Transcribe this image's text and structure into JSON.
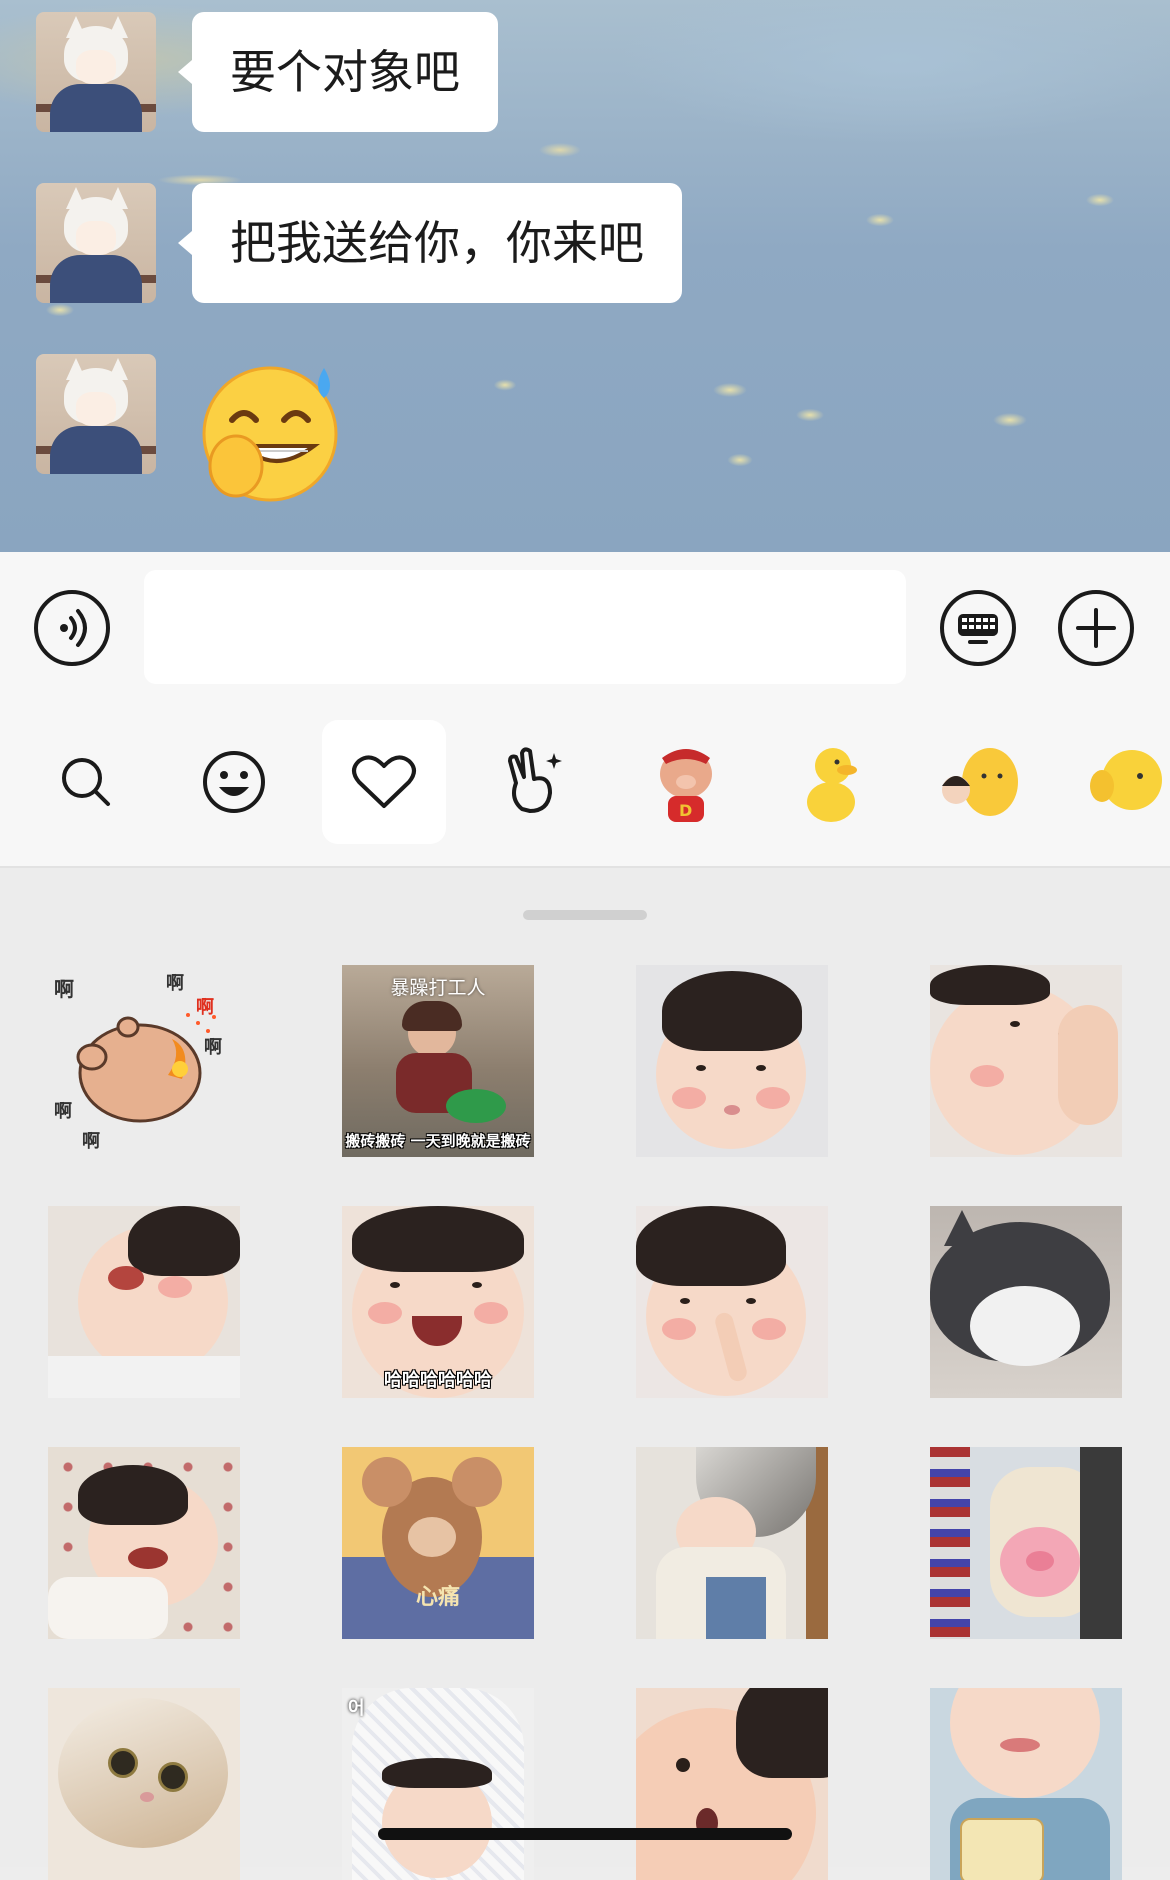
{
  "chat": {
    "messages": [
      {
        "type": "text",
        "text": "要个对象吧"
      },
      {
        "type": "text",
        "text": "把我送给你，你来吧"
      },
      {
        "type": "sticker",
        "icon": "grinning-sweat-emoji"
      }
    ]
  },
  "input": {
    "value": "",
    "voice_icon": "voice-icon",
    "keyboard_icon": "keyboard-icon",
    "plus_icon": "plus-icon"
  },
  "sticker_tabs": [
    {
      "icon": "search-icon"
    },
    {
      "icon": "smiley-icon"
    },
    {
      "icon": "heart-icon",
      "active": true
    },
    {
      "icon": "hand-gesture-icon"
    },
    {
      "icon": "pig-sticker-pack"
    },
    {
      "icon": "yellow-duck-pack"
    },
    {
      "icon": "duck-with-kid-pack"
    },
    {
      "icon": "yellow-duck-wave-pack"
    }
  ],
  "stickers": [
    {
      "name": "bear-ah-sticker",
      "captions": [
        "啊",
        "啊",
        "啊",
        "啊",
        "啊",
        "啊"
      ]
    },
    {
      "name": "grumpy-worker-sticker",
      "top_caption": "暴躁打工人",
      "caption": "搬砖搬砖 一天到晚就是搬砖"
    },
    {
      "name": "baby-pout-sticker"
    },
    {
      "name": "baby-cheek-sticker"
    },
    {
      "name": "baby-crying-laugh-sticker"
    },
    {
      "name": "baby-laughing-sticker",
      "caption": "哈哈哈哈哈哈"
    },
    {
      "name": "baby-nose-pick-sticker"
    },
    {
      "name": "cat-peeking-sticker"
    },
    {
      "name": "baby-crying-bed-sticker"
    },
    {
      "name": "jerry-heartache-sticker",
      "caption": "心痛"
    },
    {
      "name": "baby-bowl-head-sticker"
    },
    {
      "name": "kid-pig-backpack-sticker"
    },
    {
      "name": "cat-lying-sticker"
    },
    {
      "name": "baby-towel-sticker",
      "top_caption": "어"
    },
    {
      "name": "baby-closeup-sticker"
    },
    {
      "name": "baby-milk-sticker"
    }
  ],
  "colors": {
    "bubble": "#ffffff",
    "input_bar": "#f7f7f7",
    "panel": "#ececec",
    "icon_stroke": "#1a1a1a"
  }
}
